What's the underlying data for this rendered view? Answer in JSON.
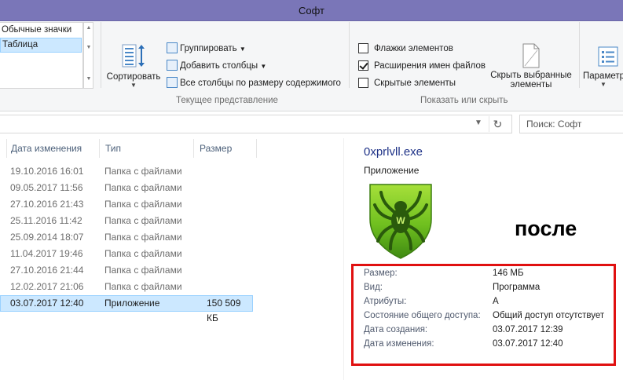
{
  "window": {
    "title": "Софт"
  },
  "ribbon": {
    "layout_items": [
      "Обычные значки",
      "Таблица"
    ],
    "sort_label": "Сортировать",
    "group_by_label": "Группировать",
    "add_columns_label": "Добавить столбцы",
    "fit_columns_label": "Все столбцы по размеру содержимого",
    "current_view_group": "Текущее представление",
    "item_checkboxes_label": "Флажки элементов",
    "file_extensions_label": "Расширения имен файлов",
    "hidden_items_label": "Скрытые элементы",
    "show_hide_group": "Показать или скрыть",
    "hide_selected_line1": "Скрыть выбранные",
    "hide_selected_line2": "элементы",
    "options_label": "Параметр",
    "item_checkboxes_checked": false,
    "file_extensions_checked": true,
    "hidden_items_checked": false
  },
  "search": {
    "placeholder": "Поиск: Софт"
  },
  "columns": {
    "date": "Дата изменения",
    "type": "Тип",
    "size": "Размер"
  },
  "rows": [
    {
      "date": "19.10.2016 16:01",
      "type": "Папка с файлами",
      "size": ""
    },
    {
      "date": "09.05.2017 11:56",
      "type": "Папка с файлами",
      "size": ""
    },
    {
      "date": "27.10.2016 21:43",
      "type": "Папка с файлами",
      "size": ""
    },
    {
      "date": "25.11.2016 11:42",
      "type": "Папка с файлами",
      "size": ""
    },
    {
      "date": "25.09.2014 18:07",
      "type": "Папка с файлами",
      "size": ""
    },
    {
      "date": "11.04.2017 19:46",
      "type": "Папка с файлами",
      "size": ""
    },
    {
      "date": "27.10.2016 21:44",
      "type": "Папка с файлами",
      "size": ""
    },
    {
      "date": "12.02.2017 21:06",
      "type": "Папка с файлами",
      "size": ""
    },
    {
      "date": "03.07.2017 12:40",
      "type": "Приложение",
      "size": "150 509 КБ"
    }
  ],
  "preview": {
    "filename": "0xprlvll.exe",
    "filetype": "Приложение",
    "annotation": "после",
    "details": [
      {
        "label": "Размер:",
        "value": "146 МБ"
      },
      {
        "label": "Вид:",
        "value": "Программа"
      },
      {
        "label": "Атрибуты:",
        "value": "A"
      },
      {
        "label": "Состояние общего доступа:",
        "value": "Общий доступ отсутствует"
      },
      {
        "label": "Дата создания:",
        "value": "03.07.2017 12:39"
      },
      {
        "label": "Дата изменения:",
        "value": "03.07.2017 12:40"
      }
    ]
  },
  "colors": {
    "titlebar": "#7a76b8",
    "selection": "#cce8ff",
    "highlight_box": "#e01010",
    "logo_green": "#6fbf1f"
  },
  "icons": [
    "sort-icon",
    "group-by-icon",
    "add-columns-icon",
    "fit-columns-icon",
    "hide-selected-icon",
    "options-icon",
    "refresh-icon",
    "drweb-spider-logo"
  ]
}
